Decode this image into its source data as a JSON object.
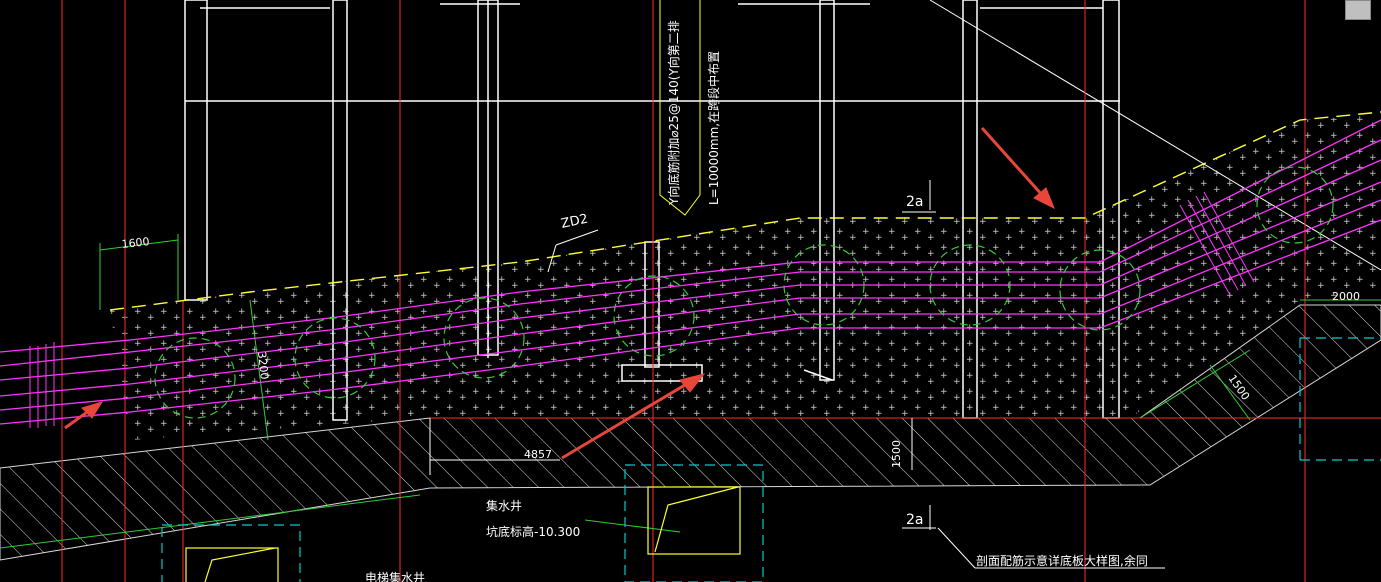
{
  "viewport": {
    "background": "#000000"
  },
  "colors": {
    "wall": "#ffffff",
    "red_axis": "#ff2a2a",
    "magenta_rebar": "#ff33ff",
    "green_dim": "#33cc33",
    "yellow_note": "#ffff33",
    "cyan_pit": "#00cccc",
    "arrow": "#e8463a"
  },
  "annotations": {
    "rebar_note": "Y向底筋附加⌀25@140(Y向第二排",
    "length_note": "L=10000mm,在跨段中布置",
    "beam_tag": "ZD2",
    "section_mark_top": "2a",
    "section_mark_bottom": "2a",
    "sump_label": "集水井",
    "sump_bottom_elev": "坑底标高-10.300",
    "detail_note": "剖面配筋示意详底板大样图,余同",
    "elevator_pit": "电梯集水井"
  },
  "dimensions": {
    "d_1600": "1600",
    "d_3200": "3200",
    "d_4857": "4857",
    "d_1500_vert": "1500",
    "d_1500_diag": "1500",
    "d_2000": "2000"
  },
  "icons": {
    "arrow_icon": "red-arrow",
    "corner_swatch": "window-swatch"
  }
}
